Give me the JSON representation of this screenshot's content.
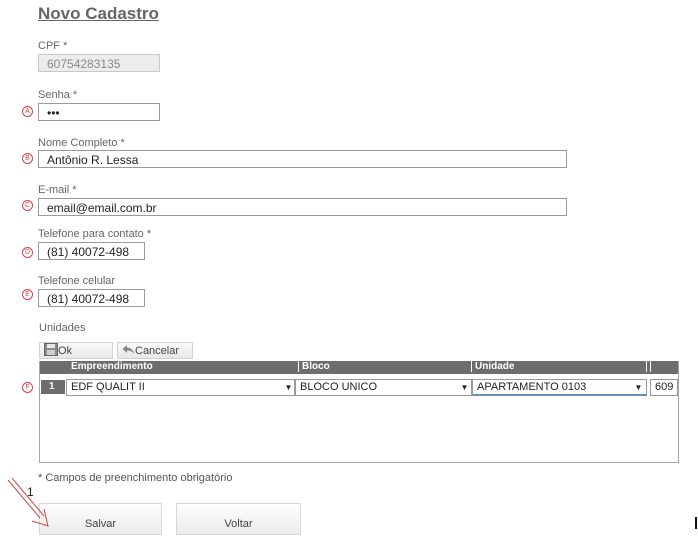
{
  "form": {
    "title": "Novo Cadastro",
    "cpf": {
      "label": "CPF *",
      "value": "60754283135"
    },
    "senha": {
      "label": "Senha *",
      "value": "•••",
      "marker": "A"
    },
    "nome": {
      "label": "Nome Completo *",
      "value": "Antônio R. Lessa",
      "marker": "B"
    },
    "email": {
      "label": "E-mail *",
      "value": "email@email.com.br",
      "marker": "C"
    },
    "telefone_contato": {
      "label": "Telefone para contato *",
      "value": "(81) 40072-498",
      "marker": "D"
    },
    "telefone_celular": {
      "label": "Telefone celular",
      "value": "(81) 40072-498",
      "marker": "E"
    }
  },
  "unidades": {
    "label": "Unidades",
    "toolbar": {
      "ok_label": "Ok",
      "cancel_label": "Cancelar"
    },
    "columns": [
      "Empreendimento",
      "Bloco",
      "Unidade",
      ""
    ],
    "row": {
      "number": "1",
      "marker": "F",
      "empreendimento": "EDF QUALIT II",
      "bloco": "BLOCO UNICO",
      "unidade": "APARTAMENTO 0103",
      "extra": "609"
    }
  },
  "required_note": "* Campos de preenchimento obrigatório",
  "buttons": {
    "save_label": "Salvar",
    "back_label": "Voltar"
  },
  "annotation": {
    "number": "1"
  },
  "colors": {
    "marker": "#d04545",
    "grid_header": "#6d6d6d",
    "arrow": "#d04545"
  }
}
